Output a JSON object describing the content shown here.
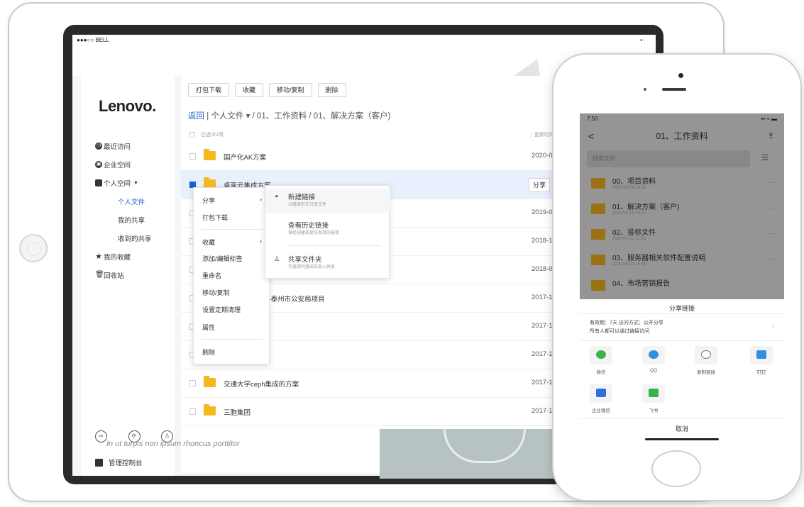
{
  "tablet": {
    "statusbar": {
      "left": "●●●○○ BELL",
      "right": "▪ ·"
    },
    "logo": "Lenovo",
    "logo_dot": ".",
    "sidebar": {
      "items": [
        {
          "label": "最近访问",
          "icon": "clock-icon"
        },
        {
          "label": "企业空间",
          "icon": "building-icon"
        },
        {
          "label": "个人空间",
          "icon": "folder-person-icon",
          "caret": "▼"
        },
        {
          "label": "个人文件",
          "sub": true,
          "active": true
        },
        {
          "label": "我的共享",
          "sub": true
        },
        {
          "label": "收到的共享",
          "sub": true
        },
        {
          "label": "我的收藏",
          "icon": "star-icon"
        },
        {
          "label": "回收站",
          "icon": "trash-icon"
        }
      ],
      "bottom_icons": [
        "link-icon",
        "share-icon",
        "user-icon"
      ],
      "admin_label": "管理控制台"
    },
    "toolbar": [
      "打包下载",
      "收藏",
      "移动/复制",
      "删除"
    ],
    "breadcrumb": {
      "back": "返回",
      "path": " | 个人文件 ▾ / 01、工作资料 / 01、解决方案（客户)"
    },
    "list_header": {
      "selected": "已选中1项",
      "time": "更新时间"
    },
    "rows": [
      {
        "name": "国产化AK方案",
        "date": "2020-0"
      },
      {
        "name": "桌面云集成方案",
        "date": "",
        "selected": true,
        "share": "分享"
      },
      {
        "name": "",
        "date": "2019-0"
      },
      {
        "name": "",
        "date": "2018-1"
      },
      {
        "name": "",
        "date": "2018-0"
      },
      {
        "name": "设方案-泰州市公安局项目",
        "date": "2017-1"
      },
      {
        "name": "案",
        "date": "2017-1"
      },
      {
        "name": "",
        "date": "2017-1"
      },
      {
        "name": "交通大学ceph集成的方案",
        "date": "2017-1"
      },
      {
        "name": "三胞集团",
        "date": "2017-1"
      }
    ],
    "context_menu": {
      "items": [
        "分享",
        "打包下载",
        "收藏",
        "添加/编辑标签",
        "重命名",
        "移动/复制",
        "设置定期清理",
        "属性",
        "删除"
      ],
      "arrow": "›"
    },
    "share_submenu": [
      {
        "title": "新建链接",
        "desc": "以链接形式分享文件",
        "icon": "link-icon"
      },
      {
        "title": "查看历史链接",
        "desc": "曾经创建或提交审批的链接",
        "icon": ""
      },
      {
        "title": "共享文件夹",
        "desc": "可邀请同盘成员加入共享",
        "icon": "user-share-icon"
      }
    ],
    "lorem": "In ut turpis non ipsum rhoncus porttitor"
  },
  "phone": {
    "status_left": "7:50",
    "status_right": "▪▪ ≈ ▬",
    "title": "01、工作资料",
    "back": "<",
    "search_placeholder": "搜索文件",
    "items": [
      {
        "name": "00、项目资料",
        "sub": "2020-05-09 14:15"
      },
      {
        "name": "01、解决方案（客户)",
        "sub": "2020-05-19 14:10"
      },
      {
        "name": "02、投标文件",
        "sub": "2020-03-21 11:26"
      },
      {
        "name": "03、服务器相关软件配置说明",
        "sub": "2020-03-01 15:35"
      },
      {
        "name": "04、市场营销报告",
        "sub": ""
      }
    ],
    "sheet_title": "分享链接",
    "sheet_info1": "有效期：7天    访问方式：公开分享",
    "sheet_info2": "所有人都可以通过链接访问",
    "apps_row1": [
      {
        "label": "微信",
        "color": "#37b54a"
      },
      {
        "label": "QQ",
        "color": "#2f8fe0"
      },
      {
        "label": "复制链接",
        "color": "#777777"
      },
      {
        "label": "钉钉",
        "color": "#2f8fe0"
      }
    ],
    "apps_row2": [
      {
        "label": "企业微信",
        "color": "#2f6fe0"
      },
      {
        "label": "飞书",
        "color": "#37b54a"
      }
    ],
    "cancel": "取消"
  }
}
